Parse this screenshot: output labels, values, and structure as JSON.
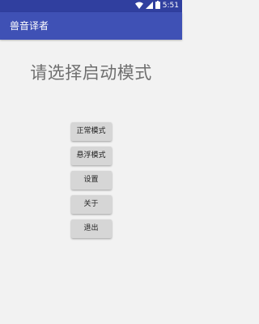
{
  "status_bar": {
    "time": "5:51",
    "icons": [
      "wifi-icon",
      "signal-icon",
      "battery-icon"
    ]
  },
  "app_bar": {
    "title": "兽音译者"
  },
  "main": {
    "heading": "请选择启动模式",
    "buttons": [
      {
        "label": "正常模式"
      },
      {
        "label": "悬浮模式"
      },
      {
        "label": "设置"
      },
      {
        "label": "关于"
      },
      {
        "label": "退出"
      }
    ]
  },
  "colors": {
    "status_bar": "#303f9f",
    "app_bar": "#3f51b5",
    "background": "#f2f2f2",
    "button": "#d6d6d6"
  }
}
